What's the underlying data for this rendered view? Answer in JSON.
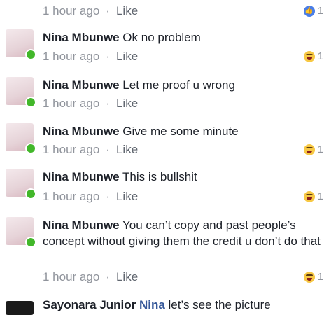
{
  "comments": [
    {
      "time": "1 hour ago",
      "like_label": "Like",
      "reaction": "like-icon",
      "reaction_count": "1"
    },
    {
      "author": "Nina Mbunwe",
      "text": "Ok no problem",
      "time": "1 hour ago",
      "like_label": "Like",
      "reaction": "haha-icon",
      "reaction_count": "1"
    },
    {
      "author": "Nina Mbunwe",
      "text": "Let me proof u wrong",
      "time": "1 hour ago",
      "like_label": "Like"
    },
    {
      "author": "Nina Mbunwe",
      "text": "Give me some minute",
      "time": "1 hour ago",
      "like_label": "Like",
      "reaction": "haha-icon",
      "reaction_count": "1"
    },
    {
      "author": "Nina Mbunwe",
      "text": "This is bullshit",
      "time": "1 hour ago",
      "like_label": "Like",
      "reaction": "haha-icon",
      "reaction_count": "1"
    },
    {
      "author": "Nina Mbunwe",
      "text": "You can’t copy and past people’s concept without giving them the credit u don’t do that",
      "time": "1 hour ago",
      "like_label": "Like",
      "reaction": "haha-icon",
      "reaction_count": "1"
    },
    {
      "author": "Sayonara Junior",
      "mention": "Nina",
      "text": "let’s see the picture"
    }
  ],
  "dot": "·",
  "colors": {
    "link": "#365899",
    "meta": "#90949c",
    "online": "#42b72a"
  }
}
